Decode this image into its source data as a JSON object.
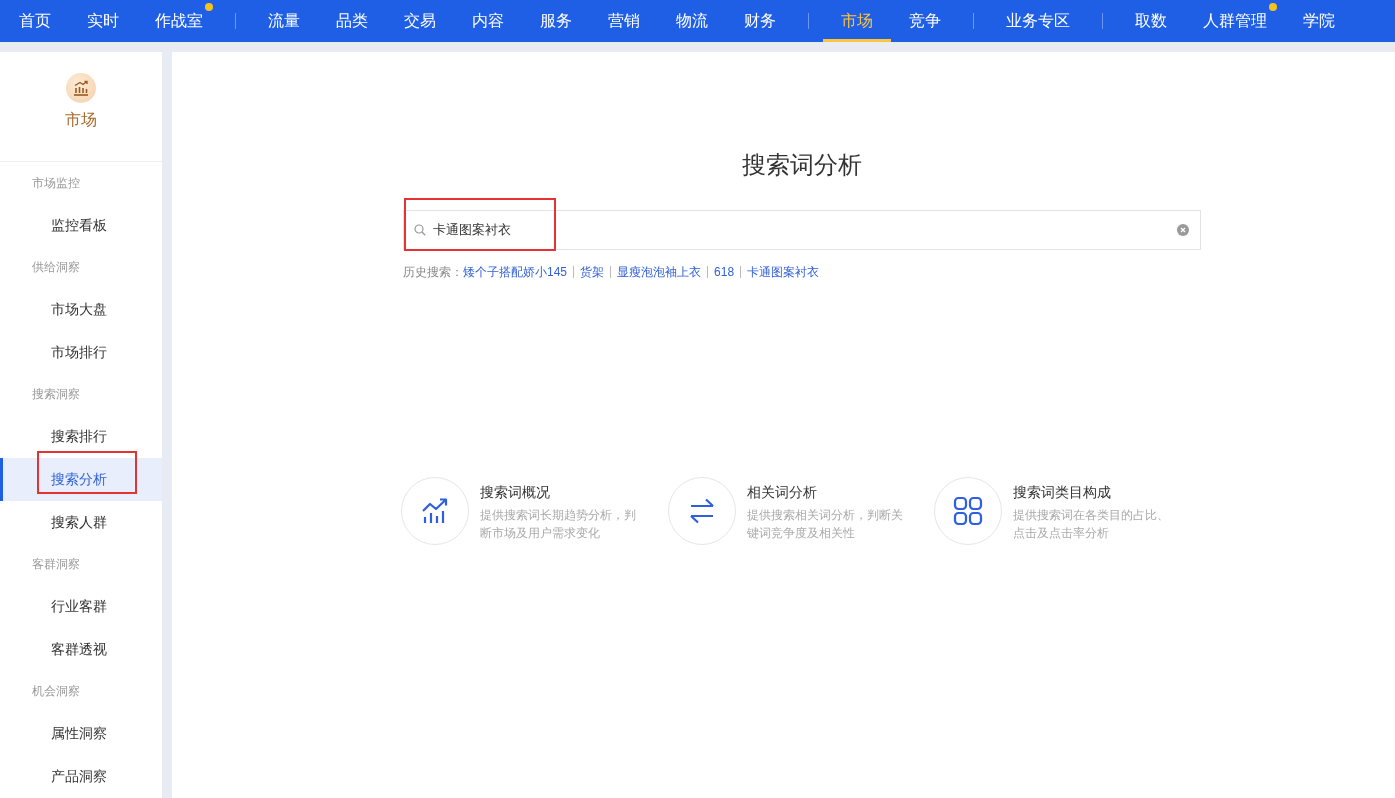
{
  "top_nav": {
    "groups": [
      {
        "items": [
          {
            "label": "首页",
            "selected": false,
            "dot": false
          },
          {
            "label": "实时",
            "selected": false,
            "dot": false
          },
          {
            "label": "作战室",
            "selected": false,
            "dot": true
          }
        ]
      },
      {
        "items": [
          {
            "label": "流量",
            "selected": false,
            "dot": false
          },
          {
            "label": "品类",
            "selected": false,
            "dot": false
          },
          {
            "label": "交易",
            "selected": false,
            "dot": false
          },
          {
            "label": "内容",
            "selected": false,
            "dot": false
          },
          {
            "label": "服务",
            "selected": false,
            "dot": false
          },
          {
            "label": "营销",
            "selected": false,
            "dot": false
          },
          {
            "label": "物流",
            "selected": false,
            "dot": false
          },
          {
            "label": "财务",
            "selected": false,
            "dot": false
          }
        ]
      },
      {
        "items": [
          {
            "label": "市场",
            "selected": true,
            "dot": false
          },
          {
            "label": "竞争",
            "selected": false,
            "dot": false
          }
        ]
      },
      {
        "items": [
          {
            "label": "业务专区",
            "selected": false,
            "dot": false
          }
        ]
      },
      {
        "items": [
          {
            "label": "取数",
            "selected": false,
            "dot": false
          },
          {
            "label": "人群管理",
            "selected": false,
            "dot": true
          },
          {
            "label": "学院",
            "selected": false,
            "dot": false
          }
        ]
      }
    ]
  },
  "sidebar": {
    "header": {
      "title": "市场"
    },
    "sections": [
      {
        "label": "市场监控",
        "items": [
          {
            "label": "监控看板",
            "selected": false,
            "annotated": false
          }
        ]
      },
      {
        "label": "供给洞察",
        "items": [
          {
            "label": "市场大盘",
            "selected": false,
            "annotated": false
          },
          {
            "label": "市场排行",
            "selected": false,
            "annotated": false
          }
        ]
      },
      {
        "label": "搜索洞察",
        "items": [
          {
            "label": "搜索排行",
            "selected": false,
            "annotated": false
          },
          {
            "label": "搜索分析",
            "selected": true,
            "annotated": true
          },
          {
            "label": "搜索人群",
            "selected": false,
            "annotated": false
          }
        ]
      },
      {
        "label": "客群洞察",
        "items": [
          {
            "label": "行业客群",
            "selected": false,
            "annotated": false
          },
          {
            "label": "客群透视",
            "selected": false,
            "annotated": false
          }
        ]
      },
      {
        "label": "机会洞察",
        "items": [
          {
            "label": "属性洞察",
            "selected": false,
            "annotated": false
          },
          {
            "label": "产品洞察",
            "selected": false,
            "annotated": false
          }
        ]
      }
    ]
  },
  "main": {
    "title": "搜索词分析",
    "search": {
      "value": "卡通图案衬衣",
      "annotated": true
    },
    "history": {
      "label": "历史搜索：",
      "items": [
        "矮个子搭配娇小145",
        "货架",
        "显瘦泡泡袖上衣",
        "618",
        "卡通图案衬衣"
      ]
    },
    "features": [
      {
        "kind": "trend",
        "title": "搜索词概况",
        "description": "提供搜索词长期趋势分析，判断市场及用户需求变化"
      },
      {
        "kind": "swap",
        "title": "相关词分析",
        "description": "提供搜索相关词分析，判断关键词竞争度及相关性"
      },
      {
        "kind": "grid",
        "title": "搜索词类目构成",
        "description": "提供搜索词在各类目的占比、点击及点击率分析"
      }
    ]
  }
}
